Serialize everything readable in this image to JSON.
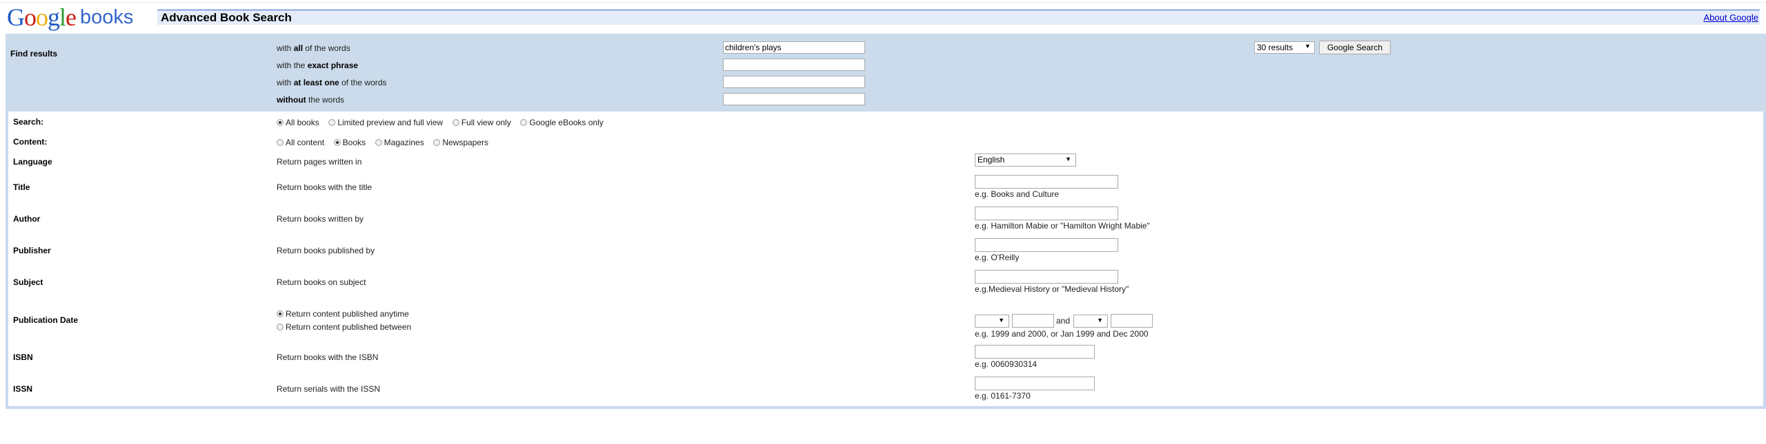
{
  "logo": {
    "google": "Google",
    "product": "books"
  },
  "header": {
    "title": "Advanced Book Search",
    "about_link": "About Google"
  },
  "find": {
    "label": "Find results",
    "rows": [
      {
        "pre": "with ",
        "bold": "all",
        "post": " of the words",
        "value": "children's plays"
      },
      {
        "pre": "with the ",
        "bold": "exact phrase",
        "post": "",
        "value": ""
      },
      {
        "pre": "with ",
        "bold": "at least one",
        "post": " of the words",
        "value": ""
      },
      {
        "pre": "",
        "bold": "without",
        "post": " the words",
        "value": ""
      }
    ],
    "results_select": "30 results",
    "search_button": "Google Search"
  },
  "search": {
    "label": "Search:",
    "options": [
      {
        "label": "All books",
        "checked": true
      },
      {
        "label": "Limited preview and full view",
        "checked": false
      },
      {
        "label": "Full view only",
        "checked": false
      },
      {
        "label": "Google eBooks only",
        "checked": false
      }
    ]
  },
  "content": {
    "label": "Content:",
    "options": [
      {
        "label": "All content",
        "checked": false
      },
      {
        "label": "Books",
        "checked": true
      },
      {
        "label": "Magazines",
        "checked": false
      },
      {
        "label": "Newspapers",
        "checked": false
      }
    ]
  },
  "language": {
    "label": "Language",
    "desc": "Return pages written in",
    "value": "English"
  },
  "title": {
    "label": "Title",
    "desc": "Return books with the title",
    "hint": "e.g. Books and Culture",
    "value": ""
  },
  "author": {
    "label": "Author",
    "desc": "Return books written by",
    "hint": "e.g. Hamilton Mabie or \"Hamilton Wright Mabie\"",
    "value": ""
  },
  "publisher": {
    "label": "Publisher",
    "desc": "Return books published by",
    "hint": "e.g. O'Reilly",
    "value": ""
  },
  "subject": {
    "label": "Subject",
    "desc": "Return books on subject",
    "hint": "e.g.Medieval History or \"Medieval History\"",
    "value": ""
  },
  "pubdate": {
    "label": "Publication Date",
    "options": [
      {
        "label": "Return content published anytime",
        "checked": true
      },
      {
        "label": "Return content published between",
        "checked": false
      }
    ],
    "and_text": "and",
    "hint": "e.g. 1999 and 2000, or Jan 1999 and Dec 2000"
  },
  "isbn": {
    "label": "ISBN",
    "desc": "Return books with the ISBN",
    "hint": "e.g. 0060930314",
    "value": ""
  },
  "issn": {
    "label": "ISSN",
    "desc": "Return serials with the ISSN",
    "hint": "e.g. 0161-7370",
    "value": ""
  }
}
